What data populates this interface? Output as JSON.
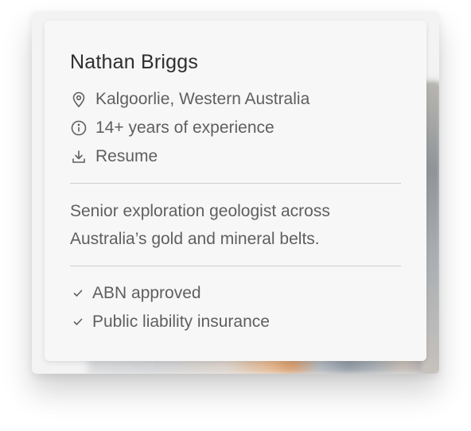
{
  "profile": {
    "name": "Nathan Briggs",
    "location": "Kalgoorlie, Western Australia",
    "experience": "14+ years of experience",
    "resume_label": "Resume",
    "bio": "Senior exploration geologist across Australia’s gold and mineral belts.",
    "verifications": [
      {
        "label": "ABN approved",
        "icon": "check-icon"
      },
      {
        "label": "Public liability insurance",
        "icon": "check-icon"
      }
    ]
  },
  "icons": {
    "location": "map-pin-icon",
    "experience": "info-icon",
    "resume": "download-icon"
  },
  "colors": {
    "text_primary": "#2e2e2e",
    "text_secondary": "#5f5f5f",
    "card_background": "#f7f7f7",
    "divider": "#cfcfcf"
  }
}
